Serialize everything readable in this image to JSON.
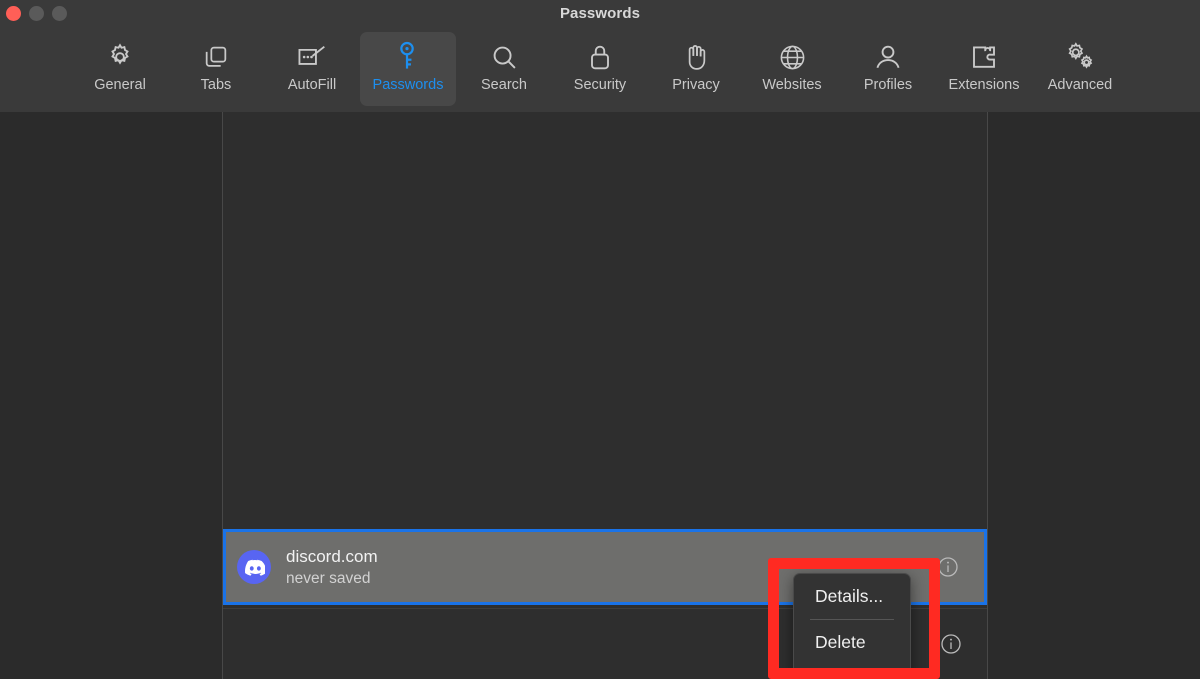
{
  "window": {
    "title": "Passwords",
    "traffic_lights": [
      {
        "name": "close",
        "color": "#ff5f57"
      },
      {
        "name": "minimize",
        "color": "#5a5a5a"
      },
      {
        "name": "maximize",
        "color": "#5a5a5a"
      }
    ]
  },
  "toolbar": {
    "active_tab": "Passwords",
    "active_color": "#1d8fef",
    "items": [
      {
        "label": "General",
        "icon": "gear-icon"
      },
      {
        "label": "Tabs",
        "icon": "tabs-icon"
      },
      {
        "label": "AutoFill",
        "icon": "autofill-icon"
      },
      {
        "label": "Passwords",
        "icon": "key-icon"
      },
      {
        "label": "Search",
        "icon": "search-icon"
      },
      {
        "label": "Security",
        "icon": "lock-icon"
      },
      {
        "label": "Privacy",
        "icon": "hand-icon"
      },
      {
        "label": "Websites",
        "icon": "globe-icon"
      },
      {
        "label": "Profiles",
        "icon": "person-icon"
      },
      {
        "label": "Extensions",
        "icon": "puzzle-icon"
      },
      {
        "label": "Advanced",
        "icon": "gears-icon"
      }
    ]
  },
  "passwords_list": {
    "rows": [
      {
        "host": "discord.com",
        "status": "never saved",
        "favicon": "discord-icon",
        "favicon_color": "#5865f2",
        "selected": true,
        "selection_border_color": "#1a73e8",
        "info_icon": "info-icon"
      },
      {
        "host": "",
        "status": "",
        "selected": false,
        "info_icon": "info-icon"
      }
    ]
  },
  "context_menu": {
    "items": [
      {
        "label": "Details..."
      },
      {
        "label": "Delete"
      }
    ]
  },
  "annotation": {
    "color": "#ff2a22",
    "shape": "rectangle-outline"
  }
}
